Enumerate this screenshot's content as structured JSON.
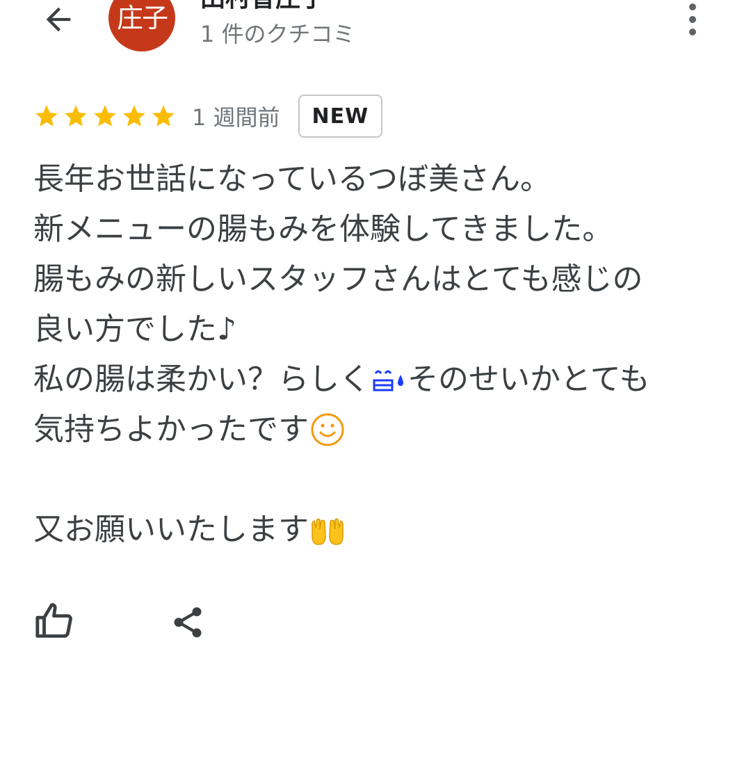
{
  "header": {
    "back_icon": "arrow-back-icon",
    "avatar_text": "庄子",
    "avatar_color": "#c5391a",
    "reviewer_name": "田村香庄子",
    "review_count": "1 件のクチコミ",
    "more_icon": "more-vert-icon"
  },
  "review": {
    "rating": 5,
    "rating_max": 5,
    "star_color": "#fbbc04",
    "time_ago": "1 週間前",
    "badge": "NEW",
    "lines": [
      {
        "text": "長年お世話になっているつぼ美さん。"
      },
      {
        "text": "新メニューの腸もみを体験してきました。"
      },
      {
        "text": "腸もみの新しいスタッフさんはとても感じの"
      },
      {
        "text": "良い方でした♪"
      },
      {
        "text_before": "私の腸は柔かい？らしく",
        "emoji": "sweat-smile-icon",
        "text_after": "そのせいかとても"
      },
      {
        "text": "気持ちよかったです",
        "emoji": "smiling-face-icon"
      },
      {
        "text": "又お願いいたします",
        "emoji": "palms-up-together-icon"
      }
    ]
  },
  "actions": {
    "like_icon": "thumbs-up-icon",
    "share_icon": "share-icon"
  }
}
